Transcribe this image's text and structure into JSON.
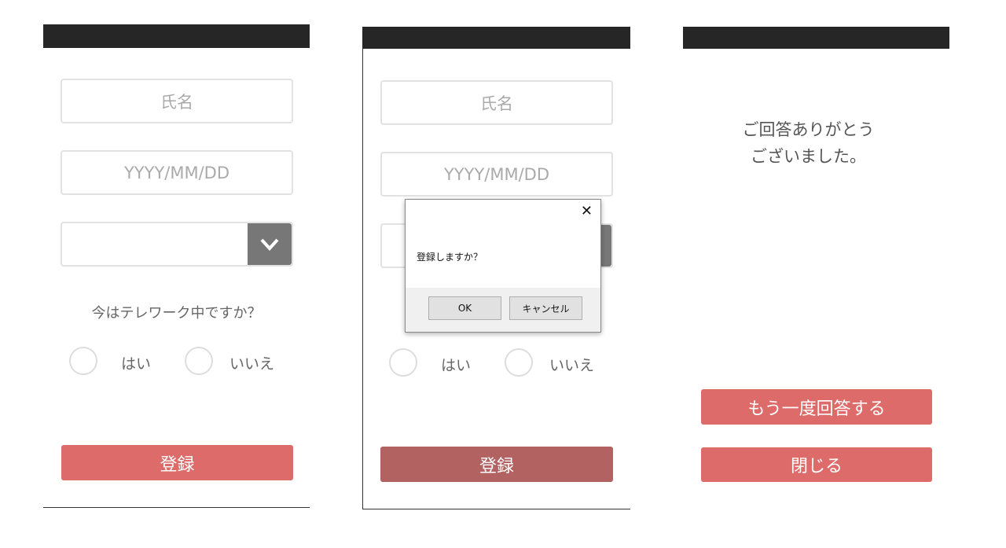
{
  "screens": [
    {
      "name_placeholder": "氏名",
      "date_placeholder": "YYYY/MM/DD",
      "question": "今はテレワーク中ですか？",
      "yes_label": "はい",
      "no_label": "いいえ",
      "submit_label": "登録"
    },
    {
      "name_placeholder": "氏名",
      "date_placeholder": "YYYY/MM/DD",
      "yes_label": "はい",
      "no_label": "いいえ",
      "submit_label": "登録",
      "dialog": {
        "message": "登録しますか？",
        "ok_label": "OK",
        "cancel_label": "キャンセル",
        "close_icon": "close-icon"
      }
    },
    {
      "thanks_line1": "ご回答ありがとう",
      "thanks_line2": "ございました。",
      "again_label": "もう一度回答する",
      "close_label": "閉じる"
    }
  ],
  "colors": {
    "header": "#262626",
    "accent": "#dc6b6a",
    "accent_dimmed": "#b36262",
    "select_arrow": "#777777"
  }
}
